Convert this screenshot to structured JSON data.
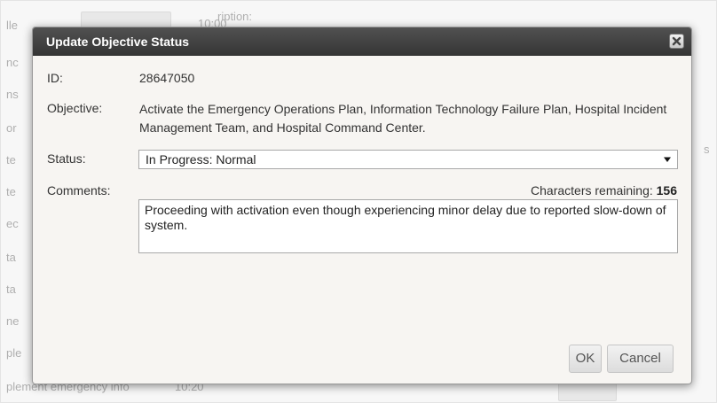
{
  "background": {
    "labels": [
      "lle",
      "nc",
      "ns",
      "or",
      "te",
      "te",
      "ec",
      "ta",
      "ta",
      "ne",
      "ple",
      "plement emergency info"
    ],
    "header_fragment": "ription:",
    "time_fragment_top": "10:00",
    "time_fragment_bottom": "10:20",
    "side_fragment": "s"
  },
  "dialog": {
    "title": "Update Objective Status",
    "close_icon": "close-icon",
    "id_label": "ID:",
    "id_value": "28647050",
    "objective_label": "Objective:",
    "objective_value": "Activate the Emergency Operations Plan, Information Technology Failure Plan, Hospital Incident Management Team, and Hospital Command Center.",
    "status_label": "Status:",
    "status_value": "In Progress: Normal",
    "status_arrow_icon": "dropdown-arrow-icon",
    "comments_label": "Comments:",
    "chars_remaining_label": "Characters remaining:",
    "chars_remaining_count": "156",
    "comments_value": "Proceeding with activation even though experiencing minor delay due to reported slow-down of  system.",
    "ok_label": "OK",
    "cancel_label": "Cancel"
  },
  "colors": {
    "titlebar": "#3f3f3f",
    "dialog_bg": "#f7f5f2",
    "button_text": "#555555"
  }
}
